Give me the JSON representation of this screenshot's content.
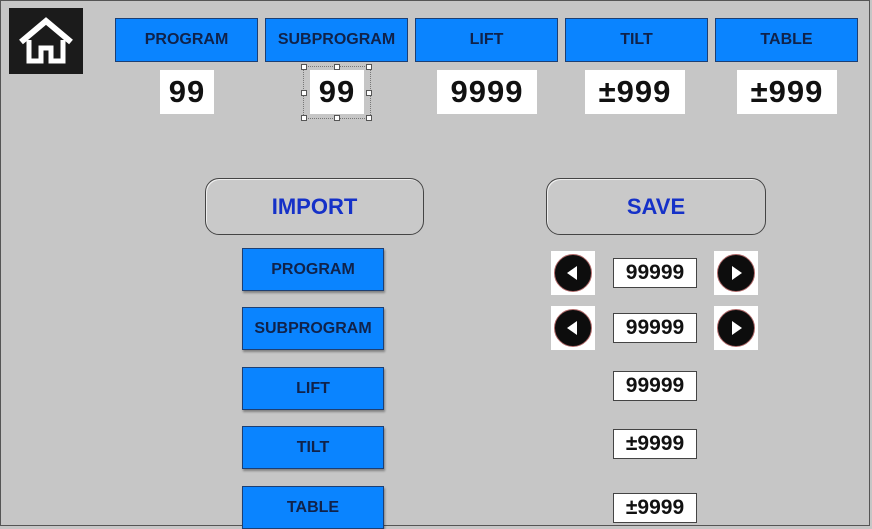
{
  "colors": {
    "button_blue": "#0a84ff",
    "accent_text": "#1531c8",
    "background": "#c6c6c6"
  },
  "header": {
    "home_icon": "home-icon",
    "buttons": [
      {
        "label": "PROGRAM",
        "value": "99"
      },
      {
        "label": "SUBPROGRAM",
        "value": "99"
      },
      {
        "label": "LIFT",
        "value": "9999"
      },
      {
        "label": "TILT",
        "value": "±999"
      },
      {
        "label": "TABLE",
        "value": "±999"
      }
    ]
  },
  "actions": {
    "import_label": "IMPORT",
    "save_label": "SAVE"
  },
  "import_list": {
    "items": [
      {
        "label": "PROGRAM",
        "value": "99999"
      },
      {
        "label": "SUBPROGRAM",
        "value": "99999"
      },
      {
        "label": "LIFT",
        "value": "99999"
      },
      {
        "label": "TILT",
        "value": "±9999"
      },
      {
        "label": "TABLE",
        "value": "±9999"
      }
    ]
  },
  "icons": {
    "left": "arrow-left-icon",
    "right": "arrow-right-icon"
  }
}
